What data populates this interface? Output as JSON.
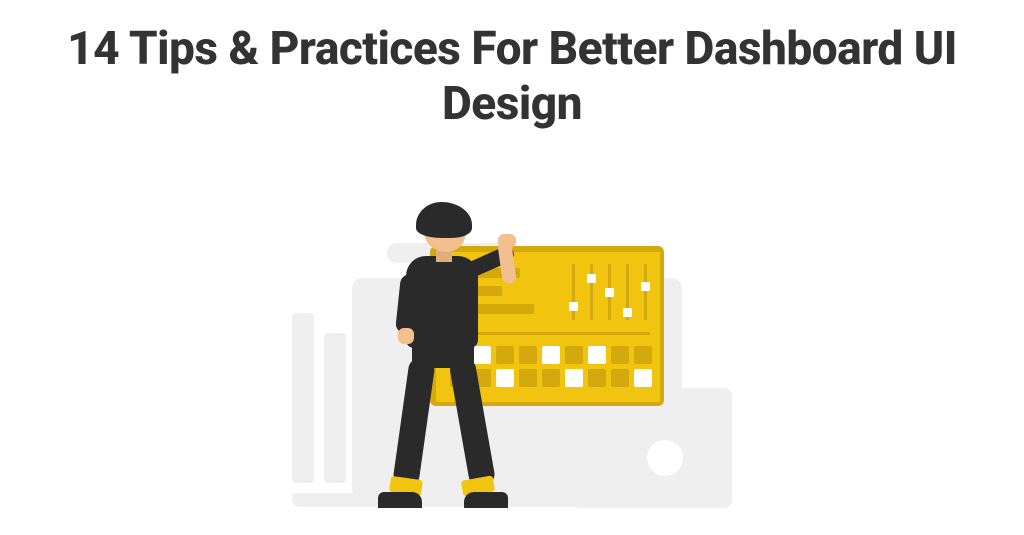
{
  "title": "14 Tips & Practices For Better Dashboard UI Design"
}
